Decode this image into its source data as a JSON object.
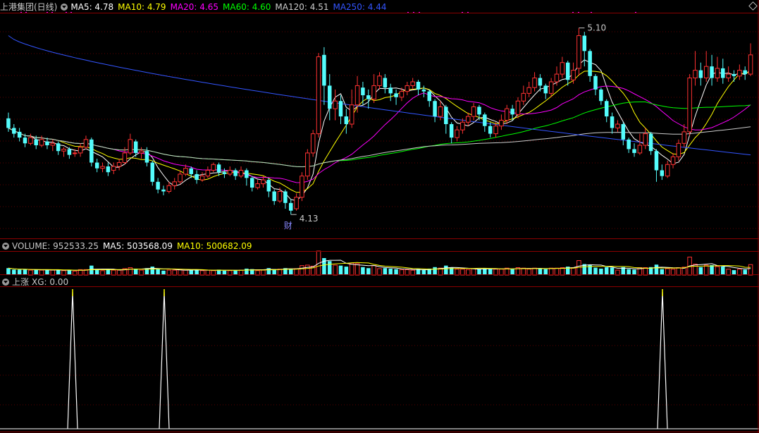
{
  "colors": {
    "ma5": "#ffffff",
    "ma10": "#ffff00",
    "ma20": "#ff00ff",
    "ma60": "#00ff00",
    "ma120": "#cccccc",
    "ma250": "#3355ff",
    "up": "#ff3232",
    "down": "#54fcfc",
    "panel_border": "#8b0000",
    "grid": "#5a0000",
    "volume_ma5": "#ffffff",
    "volume_ma10": "#ffff00"
  },
  "main_panel": {
    "title": "上港集团(日线)",
    "indicators": [
      {
        "label": "MA5: 4.78",
        "color": "#ffffff"
      },
      {
        "label": "MA10: 4.79",
        "color": "#ffff00"
      },
      {
        "label": "MA20: 4.65",
        "color": "#ff00ff"
      },
      {
        "label": "MA60: 4.60",
        "color": "#00ff00"
      },
      {
        "label": "MA120: 4.51",
        "color": "#cccccc"
      },
      {
        "label": "MA250: 4.44",
        "color": "#3355ff"
      }
    ],
    "high_label": "5.10",
    "low_label": "4.13",
    "event_marker": "财"
  },
  "volume_panel": {
    "volume_label": "VOLUME: 952533.25",
    "ma5_label": "MA5: 503568.09",
    "ma10_label": "MA10: 500682.09"
  },
  "xg_panel": {
    "title": "上涨",
    "value_label": "XG: 0.00"
  },
  "chart_data": {
    "type": "candlestick",
    "title": "上港集团(日线)",
    "price_range": [
      4.05,
      5.15
    ],
    "high": 5.1,
    "low": 4.13,
    "candles": [
      [
        4.63,
        4.58,
        4.66,
        4.56
      ],
      [
        4.58,
        4.55,
        4.6,
        4.53
      ],
      [
        4.56,
        4.53,
        4.58,
        4.51
      ],
      [
        4.53,
        4.5,
        4.55,
        4.48
      ],
      [
        4.5,
        4.53,
        4.55,
        4.49
      ],
      [
        4.52,
        4.49,
        4.54,
        4.47
      ],
      [
        4.49,
        4.52,
        4.54,
        4.48
      ],
      [
        4.51,
        4.49,
        4.53,
        4.47
      ],
      [
        4.49,
        4.5,
        4.52,
        4.46
      ],
      [
        4.5,
        4.46,
        4.51,
        4.44
      ],
      [
        4.46,
        4.47,
        4.48,
        4.43
      ],
      [
        4.47,
        4.44,
        4.48,
        4.42
      ],
      [
        4.45,
        4.45,
        4.47,
        4.43
      ],
      [
        4.45,
        4.48,
        4.5,
        4.43
      ],
      [
        4.48,
        4.52,
        4.54,
        4.47
      ],
      [
        4.52,
        4.4,
        4.53,
        4.38
      ],
      [
        4.4,
        4.37,
        4.42,
        4.35
      ],
      [
        4.37,
        4.38,
        4.4,
        4.35
      ],
      [
        4.38,
        4.35,
        4.4,
        4.33
      ],
      [
        4.36,
        4.38,
        4.4,
        4.34
      ],
      [
        4.38,
        4.4,
        4.42,
        4.36
      ],
      [
        4.4,
        4.45,
        4.48,
        4.39
      ],
      [
        4.45,
        4.52,
        4.55,
        4.44
      ],
      [
        4.51,
        4.45,
        4.52,
        4.43
      ],
      [
        4.45,
        4.46,
        4.48,
        4.42
      ],
      [
        4.46,
        4.4,
        4.48,
        4.38
      ],
      [
        4.4,
        4.3,
        4.41,
        4.28
      ],
      [
        4.3,
        4.26,
        4.32,
        4.24
      ],
      [
        4.26,
        4.25,
        4.28,
        4.23
      ],
      [
        4.25,
        4.28,
        4.3,
        4.24
      ],
      [
        4.28,
        4.3,
        4.32,
        4.26
      ],
      [
        4.3,
        4.34,
        4.36,
        4.29
      ],
      [
        4.34,
        4.37,
        4.39,
        4.33
      ],
      [
        4.37,
        4.34,
        4.38,
        4.32
      ],
      [
        4.34,
        4.31,
        4.36,
        4.29
      ],
      [
        4.31,
        4.33,
        4.35,
        4.3
      ],
      [
        4.33,
        4.36,
        4.38,
        4.32
      ],
      [
        4.36,
        4.39,
        4.4,
        4.35
      ],
      [
        4.39,
        4.35,
        4.4,
        4.33
      ],
      [
        4.35,
        4.34,
        4.37,
        4.32
      ],
      [
        4.34,
        4.36,
        4.38,
        4.33
      ],
      [
        4.36,
        4.33,
        4.37,
        4.31
      ],
      [
        4.33,
        4.36,
        4.38,
        4.32
      ],
      [
        4.36,
        4.32,
        4.37,
        4.28
      ],
      [
        4.32,
        4.27,
        4.33,
        4.25
      ],
      [
        4.27,
        4.29,
        4.31,
        4.26
      ],
      [
        4.29,
        4.31,
        4.33,
        4.27
      ],
      [
        4.31,
        4.25,
        4.32,
        4.22
      ],
      [
        4.25,
        4.2,
        4.26,
        4.18
      ],
      [
        4.2,
        4.25,
        4.27,
        4.19
      ],
      [
        4.25,
        4.19,
        4.26,
        4.16
      ],
      [
        4.19,
        4.15,
        4.21,
        4.13
      ],
      [
        4.16,
        4.22,
        4.24,
        4.15
      ],
      [
        4.22,
        4.33,
        4.35,
        4.2
      ],
      [
        4.33,
        4.45,
        4.47,
        4.31
      ],
      [
        4.45,
        4.55,
        4.57,
        4.43
      ],
      [
        4.55,
        4.95,
        4.97,
        4.53
      ],
      [
        4.96,
        4.8,
        5.0,
        4.7
      ],
      [
        4.8,
        4.68,
        4.86,
        4.62
      ],
      [
        4.68,
        4.72,
        4.78,
        4.62
      ],
      [
        4.72,
        4.64,
        4.75,
        4.6
      ],
      [
        4.64,
        4.6,
        4.68,
        4.55
      ],
      [
        4.6,
        4.7,
        4.78,
        4.58
      ],
      [
        4.7,
        4.8,
        4.85,
        4.66
      ],
      [
        4.79,
        4.75,
        4.82,
        4.7
      ],
      [
        4.75,
        4.73,
        4.78,
        4.68
      ],
      [
        4.73,
        4.8,
        4.86,
        4.71
      ],
      [
        4.8,
        4.85,
        4.87,
        4.78
      ],
      [
        4.84,
        4.79,
        4.86,
        4.76
      ],
      [
        4.79,
        4.76,
        4.81,
        4.72
      ],
      [
        4.76,
        4.74,
        4.78,
        4.7
      ],
      [
        4.74,
        4.77,
        4.79,
        4.72
      ],
      [
        4.77,
        4.8,
        4.82,
        4.75
      ],
      [
        4.8,
        4.82,
        4.84,
        4.78
      ],
      [
        4.82,
        4.78,
        4.83,
        4.75
      ],
      [
        4.78,
        4.77,
        4.8,
        4.74
      ],
      [
        4.77,
        4.72,
        4.78,
        4.69
      ],
      [
        4.72,
        4.64,
        4.73,
        4.61
      ],
      [
        4.64,
        4.69,
        4.72,
        4.62
      ],
      [
        4.69,
        4.6,
        4.7,
        4.55
      ],
      [
        4.6,
        4.53,
        4.61,
        4.5
      ],
      [
        4.53,
        4.57,
        4.59,
        4.51
      ],
      [
        4.57,
        4.61,
        4.63,
        4.55
      ],
      [
        4.61,
        4.64,
        4.66,
        4.59
      ],
      [
        4.64,
        4.69,
        4.71,
        4.62
      ],
      [
        4.69,
        4.65,
        4.7,
        4.62
      ],
      [
        4.65,
        4.59,
        4.66,
        4.56
      ],
      [
        4.59,
        4.55,
        4.61,
        4.53
      ],
      [
        4.55,
        4.59,
        4.61,
        4.53
      ],
      [
        4.59,
        4.62,
        4.65,
        4.57
      ],
      [
        4.62,
        4.68,
        4.7,
        4.6
      ],
      [
        4.68,
        4.65,
        4.7,
        4.62
      ],
      [
        4.65,
        4.72,
        4.74,
        4.63
      ],
      [
        4.72,
        4.76,
        4.8,
        4.7
      ],
      [
        4.76,
        4.79,
        4.82,
        4.74
      ],
      [
        4.79,
        4.84,
        4.87,
        4.77
      ],
      [
        4.84,
        4.8,
        4.86,
        4.77
      ],
      [
        4.8,
        4.76,
        4.81,
        4.73
      ],
      [
        4.76,
        4.82,
        4.84,
        4.74
      ],
      [
        4.82,
        4.86,
        4.9,
        4.8
      ],
      [
        4.86,
        4.92,
        4.95,
        4.84
      ],
      [
        4.92,
        4.83,
        4.93,
        4.8
      ],
      [
        4.83,
        4.88,
        4.92,
        4.81
      ],
      [
        4.89,
        5.06,
        5.1,
        4.85
      ],
      [
        5.06,
        4.98,
        5.08,
        4.9
      ],
      [
        4.98,
        4.85,
        4.99,
        4.82
      ],
      [
        4.85,
        4.78,
        4.86,
        4.75
      ],
      [
        4.78,
        4.72,
        4.79,
        4.7
      ],
      [
        4.72,
        4.64,
        4.73,
        4.61
      ],
      [
        4.64,
        4.58,
        4.66,
        4.55
      ],
      [
        4.58,
        4.6,
        4.62,
        4.56
      ],
      [
        4.6,
        4.52,
        4.61,
        4.49
      ],
      [
        4.52,
        4.47,
        4.53,
        4.45
      ],
      [
        4.47,
        4.45,
        4.5,
        4.43
      ],
      [
        4.45,
        4.49,
        4.55,
        4.44
      ],
      [
        4.49,
        4.55,
        4.58,
        4.47
      ],
      [
        4.55,
        4.46,
        4.56,
        4.44
      ],
      [
        4.46,
        4.36,
        4.47,
        4.3
      ],
      [
        4.36,
        4.33,
        4.39,
        4.31
      ],
      [
        4.33,
        4.39,
        4.41,
        4.32
      ],
      [
        4.39,
        4.43,
        4.45,
        4.37
      ],
      [
        4.43,
        4.5,
        4.52,
        4.41
      ],
      [
        4.5,
        4.56,
        4.6,
        4.48
      ],
      [
        4.56,
        4.84,
        4.86,
        4.54
      ],
      [
        4.84,
        4.88,
        4.98,
        4.8
      ],
      [
        4.88,
        4.84,
        4.92,
        4.8
      ],
      [
        4.84,
        4.9,
        4.98,
        4.82
      ],
      [
        4.9,
        4.84,
        4.96,
        4.8
      ],
      [
        4.84,
        4.89,
        4.95,
        4.82
      ],
      [
        4.89,
        4.84,
        4.94,
        4.81
      ],
      [
        4.84,
        4.86,
        4.9,
        4.82
      ],
      [
        4.86,
        4.85,
        4.88,
        4.82
      ],
      [
        4.85,
        4.88,
        4.91,
        4.83
      ],
      [
        4.88,
        4.86,
        4.9,
        4.83
      ],
      [
        4.86,
        4.96,
        5.02,
        4.85
      ]
    ]
  }
}
